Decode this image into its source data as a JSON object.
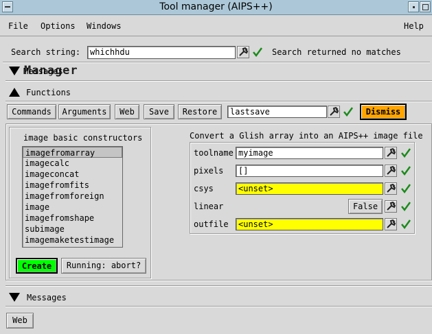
{
  "window": {
    "title": "Tool manager (AIPS++)"
  },
  "menubar": {
    "file": "File",
    "options": "Options",
    "windows": "Windows",
    "help": "Help"
  },
  "search": {
    "label": "Search string:",
    "value": "whichhdu",
    "status": "Search returned no matches"
  },
  "sections": {
    "manager": "Manager",
    "manager_overlap": "Messages",
    "functions": "Functions",
    "messages": "Messages"
  },
  "toolbar": {
    "commands": "Commands",
    "arguments": "Arguments",
    "web": "Web",
    "save": "Save",
    "restore": "Restore",
    "restore_value": "lastsave",
    "dismiss": "Dismiss"
  },
  "functions_panel": {
    "title": "image basic constructors",
    "items": [
      "imagefromarray",
      "imagecalc",
      "imageconcat",
      "imagefromfits",
      "imagefromforeign",
      "image",
      "imagefromshape",
      "subimage",
      "imagemaketestimage"
    ],
    "selected": "imagefromarray",
    "create": "Create",
    "running": "Running: abort?"
  },
  "args_panel": {
    "description": "Convert a Glish array into an AIPS++ image file",
    "rows": [
      {
        "name": "toolname",
        "value": "myimage",
        "kind": "text"
      },
      {
        "name": "pixels",
        "value": "[]",
        "kind": "text"
      },
      {
        "name": "csys",
        "value": "<unset>",
        "kind": "unset"
      },
      {
        "name": "linear",
        "value": "False",
        "kind": "bool"
      },
      {
        "name": "outfile",
        "value": "<unset>",
        "kind": "unset"
      }
    ]
  },
  "footer": {
    "web": "Web"
  },
  "colors": {
    "titlebar": "#acc8d8",
    "unset": "#ffff00",
    "create": "#00ff00",
    "dismiss": "#ffa500",
    "check": "#1a8a1a"
  },
  "icons": [
    "wrench-icon",
    "checkmark-icon",
    "triangle-down-icon",
    "triangle-up-icon"
  ]
}
